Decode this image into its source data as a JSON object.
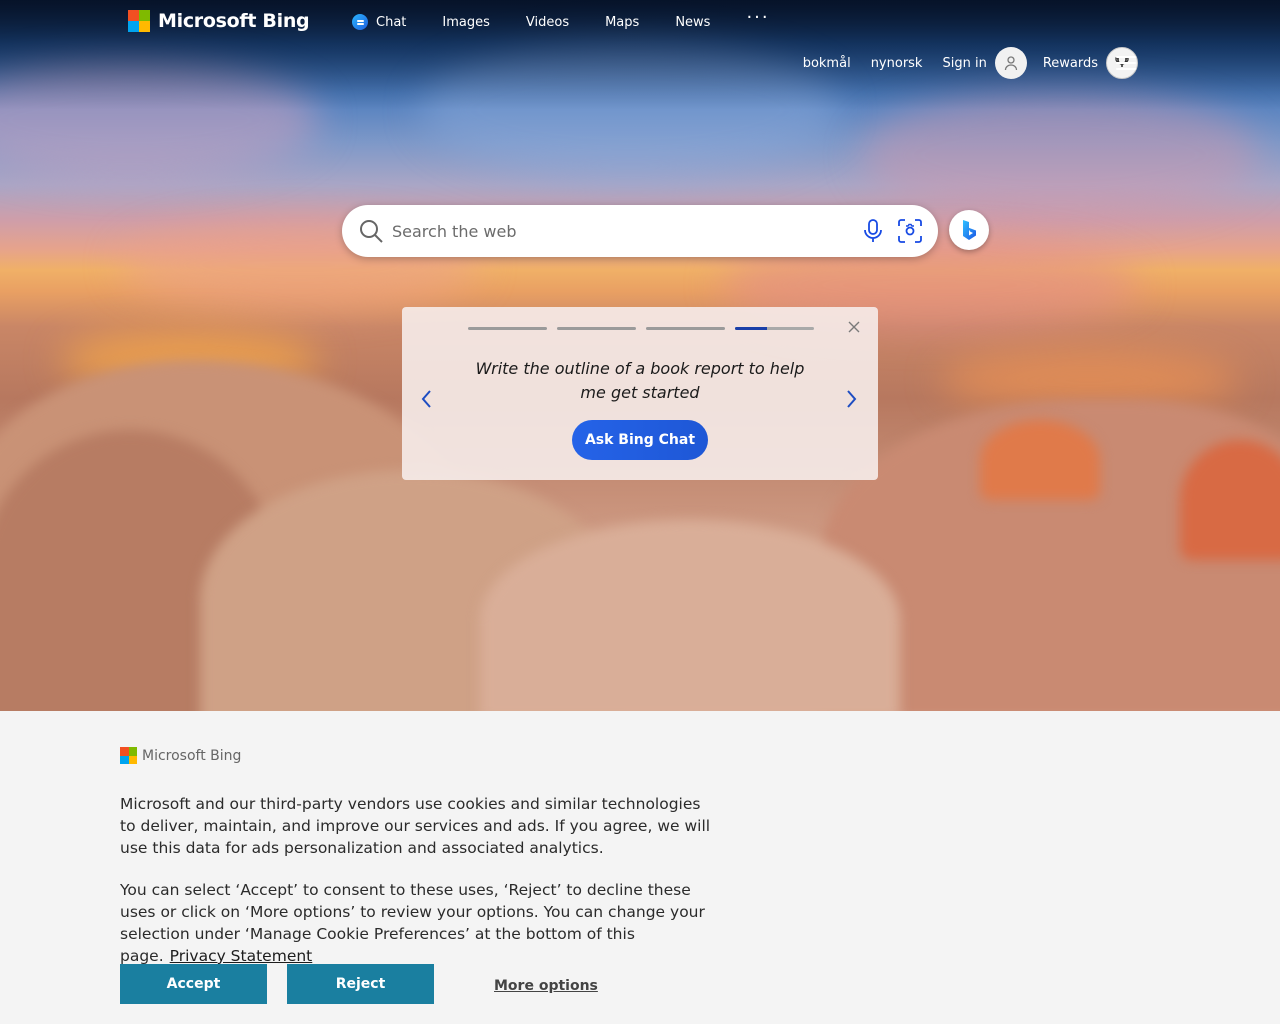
{
  "brand": {
    "name": "Microsoft Bing"
  },
  "topnav": {
    "items": [
      {
        "label": "Chat",
        "icon": "chat-bubble-icon"
      },
      {
        "label": "Images"
      },
      {
        "label": "Videos"
      },
      {
        "label": "Maps"
      },
      {
        "label": "News"
      }
    ],
    "more_label": "···"
  },
  "account": {
    "languages": [
      "bokmål",
      "nynorsk"
    ],
    "sign_in_label": "Sign in",
    "rewards_label": "Rewards"
  },
  "search": {
    "placeholder": "Search the web",
    "value": ""
  },
  "prompt_card": {
    "prompt": "Write the outline of a book report to help me get started",
    "button_label": "Ask Bing Chat",
    "progress": {
      "total": 4,
      "current": 4,
      "current_fill": 0.4
    }
  },
  "cookie_banner": {
    "brand": "Microsoft Bing",
    "paragraph1": "Microsoft and our third-party vendors use cookies and similar technologies to deliver, maintain, and improve our services and ads. If you agree, we will use this data for ads personalization and associated analytics.",
    "paragraph2": "You can select ‘Accept’ to consent to these uses, ‘Reject’ to decline these uses or click on ‘More options’ to review your options. You can change your selection under ‘Manage Cookie Preferences’ at the bottom of this page.",
    "privacy_link": "Privacy Statement",
    "accept_label": "Accept",
    "reject_label": "Reject",
    "more_options_label": "More options"
  },
  "colors": {
    "accent_blue": "#1e57d6",
    "cookie_button": "#1a7fa0",
    "progress_active": "#1a3fa8"
  }
}
